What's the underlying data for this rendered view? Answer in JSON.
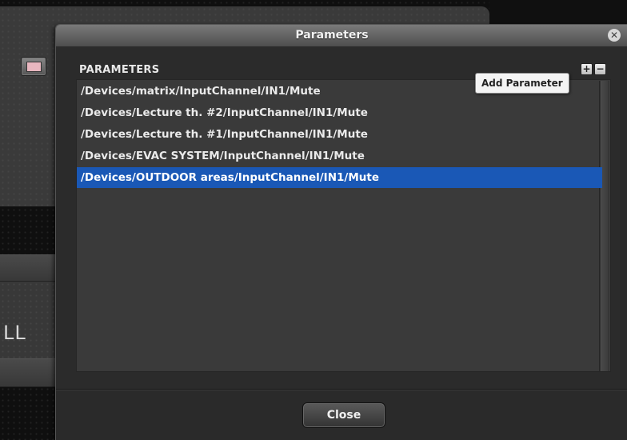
{
  "background": {
    "partial_label": "LL"
  },
  "dialog": {
    "title": "Parameters",
    "section_label": "PARAMETERS",
    "close_x": "✕",
    "add_button_glyph": "+",
    "remove_button_glyph": "−",
    "tooltip": "Add Parameter",
    "items": [
      {
        "label": "/Devices/matrix/InputChannel/IN1/Mute",
        "selected": false
      },
      {
        "label": "/Devices/Lecture th. #2/InputChannel/IN1/Mute",
        "selected": false
      },
      {
        "label": "/Devices/Lecture th. #1/InputChannel/IN1/Mute",
        "selected": false
      },
      {
        "label": "/Devices/EVAC SYSTEM/InputChannel/IN1/Mute",
        "selected": false
      },
      {
        "label": "/Devices/OUTDOOR areas/InputChannel/IN1/Mute",
        "selected": true
      }
    ],
    "footer_button": "Close"
  },
  "colors": {
    "selection": "#1a58b6",
    "dialog_bg": "#2b2b2b",
    "list_bg": "#3a3a3a"
  }
}
